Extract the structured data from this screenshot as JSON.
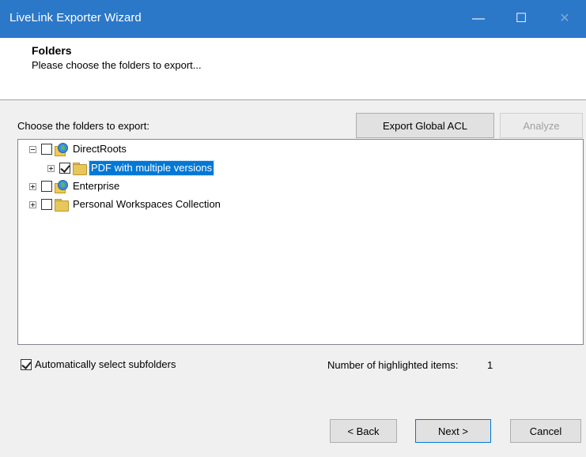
{
  "window": {
    "title": "LiveLink Exporter Wizard",
    "minimize": "—",
    "maximize": "☐",
    "close": "✕"
  },
  "header": {
    "title": "Folders",
    "subtitle": "Please choose the folders to export..."
  },
  "main": {
    "choose_label": "Choose the folders to export:",
    "export_acl_label": "Export Global ACL",
    "analyze_label": "Analyze",
    "tree": [
      {
        "label": "DirectRoots",
        "checked": false,
        "expander": "minus",
        "icon": "globe-folder-icon",
        "level": 0
      },
      {
        "label": "PDF with multiple versions",
        "checked": true,
        "expander": "plus",
        "icon": "folder-icon",
        "level": 1,
        "selected": true
      },
      {
        "label": "Enterprise",
        "checked": false,
        "expander": "plus",
        "icon": "globe-folder-icon",
        "level": 0
      },
      {
        "label": "Personal Workspaces Collection",
        "checked": false,
        "expander": "plus",
        "icon": "folder-icon",
        "level": 0
      }
    ],
    "auto_select_label": "Automatically select subfolders",
    "auto_select_checked": true,
    "highlighted_label": "Number of highlighted items:",
    "highlighted_count": "1"
  },
  "footer": {
    "back_label": "< Back",
    "next_label": "Next >",
    "cancel_label": "Cancel"
  },
  "colors": {
    "titlebar": "#2b78c8",
    "selection": "#0078d7"
  }
}
